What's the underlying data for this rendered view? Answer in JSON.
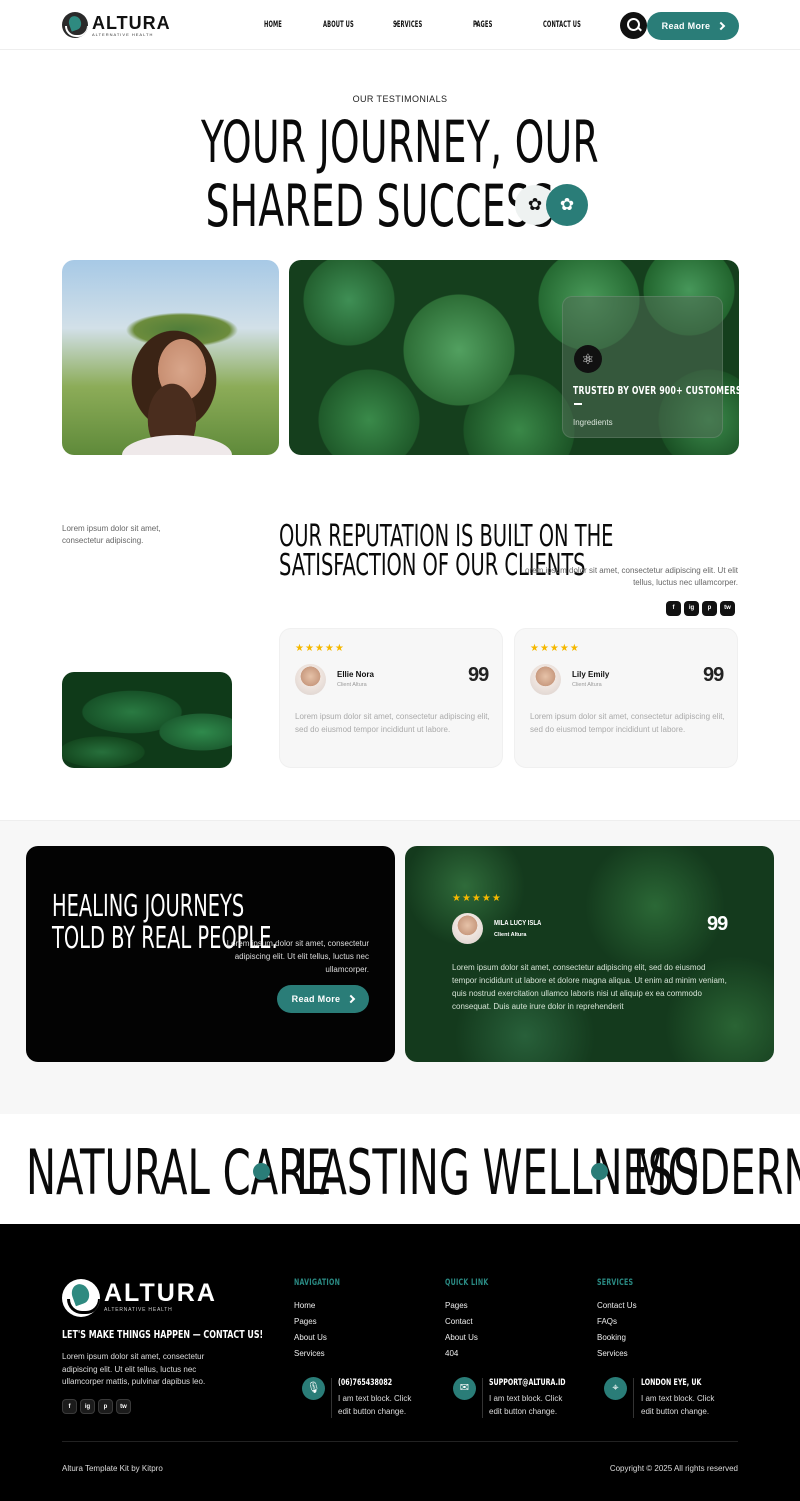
{
  "header": {
    "logo_name": "ALTURA",
    "logo_sub": "ALTERNATIVE HEALTH",
    "nav": [
      "HOME",
      "ABOUT US",
      "SERVICES",
      "PAGES",
      "CONTACT US"
    ],
    "nav_has_caret": [
      false,
      false,
      true,
      true,
      false
    ],
    "cta_label": "Read More",
    "search_icon": "search-icon"
  },
  "hero": {
    "eyebrow": "OUR TESTIMONIALS",
    "title_line1": "YOUR JOURNEY, OUR",
    "title_line2": "SHARED SUCCESS",
    "badge_icons": [
      "flower-icon",
      "flower-icon"
    ],
    "overlay_title": "TRUSTED BY OVER 900+ CUSTOMERS",
    "overlay_sub": "Ingredients",
    "overlay_icon": "atom-icon"
  },
  "reputation": {
    "side_text": "Lorem ipsum dolor sit amet, consectetur adipiscing.",
    "title": "OUR REPUTATION IS BUILT ON THE SATISFACTION OF OUR CLIENTS",
    "desc": "Lorem ipsum dolor sit amet, consectetur adipiscing elit. Ut elit tellus, luctus nec ullamcorper.",
    "social": [
      "f",
      "ig",
      "p",
      "tw"
    ],
    "testimonials": [
      {
        "stars": "★★★★★",
        "rating": 5,
        "name": "Ellie Nora",
        "role": "Client Altura",
        "quote_mark": "99",
        "text": "Lorem ipsum dolor sit amet, consectetur adipiscing elit, sed do eiusmod tempor incididunt ut labore."
      },
      {
        "stars": "★★★★★",
        "rating": 5,
        "name": "Lily Emily",
        "role": "Client Altura",
        "quote_mark": "99",
        "text": "Lorem ipsum dolor sit amet, consectetur adipiscing elit, sed do eiusmod tempor incididunt ut labore."
      }
    ]
  },
  "healing": {
    "title": "HEALING JOURNEYS TOLD BY REAL PEOPLE.",
    "desc": "Lorem ipsum dolor sit amet, consectetur adipiscing elit. Ut elit tellus, luctus nec ullamcorper.",
    "cta_label": "Read More",
    "featured": {
      "stars": "★★★★★",
      "rating": 5,
      "name": "MILA LUCY ISLA",
      "role": "Client Altura",
      "quote_mark": "99",
      "text": "Lorem ipsum dolor sit amet, consectetur adipiscing elit, sed do eiusmod tempor incididunt ut labore et dolore magna aliqua. Ut enim ad minim veniam, quis nostrud exercitation ullamco laboris nisi ut aliquip ex ea commodo consequat. Duis aute irure dolor in reprehenderit"
    }
  },
  "marquee": {
    "items": [
      "NATURAL CARE",
      "LASTING WELLNESS",
      "MODERN WE"
    ],
    "accent": "#2a7d78"
  },
  "footer": {
    "logo_name": "ALTURA",
    "logo_sub": "ALTERNATIVE HEALTH",
    "tagline": "LET'S MAKE THINGS HAPPEN — CONTACT US!",
    "desc": "Lorem ipsum dolor sit amet, consectetur adipiscing elit. Ut elit tellus, luctus nec ullamcorper mattis, pulvinar dapibus leo.",
    "social": [
      "f",
      "ig",
      "p",
      "tw"
    ],
    "columns": [
      {
        "title": "NAVIGATION",
        "links": [
          "Home",
          "Pages",
          "About Us",
          "Services"
        ]
      },
      {
        "title": "QUICK LINK",
        "links": [
          "Pages",
          "Contact",
          "About Us",
          "404"
        ]
      },
      {
        "title": "SERVICES",
        "links": [
          "Contact Us",
          "FAQs",
          "Booking",
          "Services"
        ]
      }
    ],
    "contacts": [
      {
        "icon": "microphone-icon",
        "title": "(06)765438082",
        "text": "I am text block. Click edit button  change."
      },
      {
        "icon": "mail-icon",
        "title": "SUPPORT@ALTURA.ID",
        "text": "I am text block. Click edit button  change."
      },
      {
        "icon": "location-pin-icon",
        "title": "LONDON EYE, UK",
        "text": "I am text block. Click edit button  change."
      }
    ],
    "copy_left": "Altura Template Kit by Kitpro",
    "copy_right": "Copyright © 2025 All rights reserved"
  },
  "colors": {
    "accent": "#2a7d78",
    "dark": "#000000",
    "star": "#f5b800"
  }
}
